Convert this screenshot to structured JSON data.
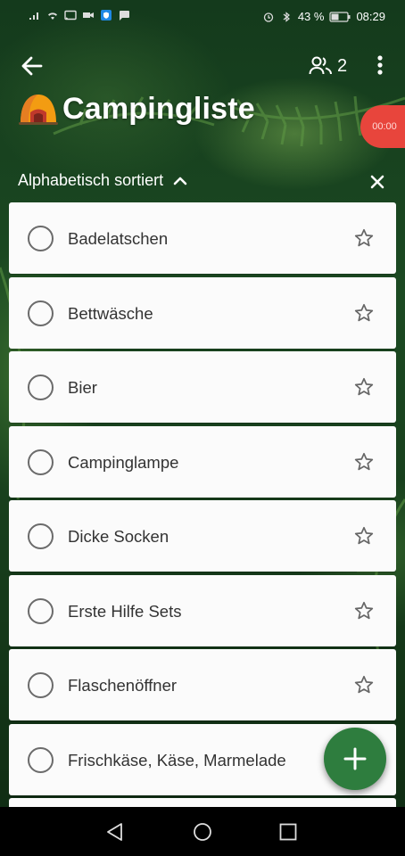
{
  "status_bar": {
    "battery": "43 %",
    "time": "08:29",
    "left_icons": [
      "signal-icon",
      "wifi-icon",
      "cast-icon",
      "video-icon",
      "shield-app-icon",
      "chat-icon"
    ],
    "right_icons": [
      "alarm-icon",
      "bluetooth-icon",
      "battery-icon"
    ]
  },
  "header": {
    "title": "Campingliste",
    "share_count": "2",
    "timer": "00:00"
  },
  "sort": {
    "label": "Alphabetisch sortiert"
  },
  "items": [
    {
      "label": "Badelatschen"
    },
    {
      "label": "Bettwäsche"
    },
    {
      "label": "Bier"
    },
    {
      "label": "Campinglampe"
    },
    {
      "label": "Dicke Socken"
    },
    {
      "label": "Erste Hilfe Sets"
    },
    {
      "label": "Flaschenöffner"
    },
    {
      "label": "Frischkäse, Käse, Marmelade"
    }
  ],
  "colors": {
    "fab": "#2e7d3e",
    "timer": "#e8453c",
    "card": "#fbfbfb"
  }
}
